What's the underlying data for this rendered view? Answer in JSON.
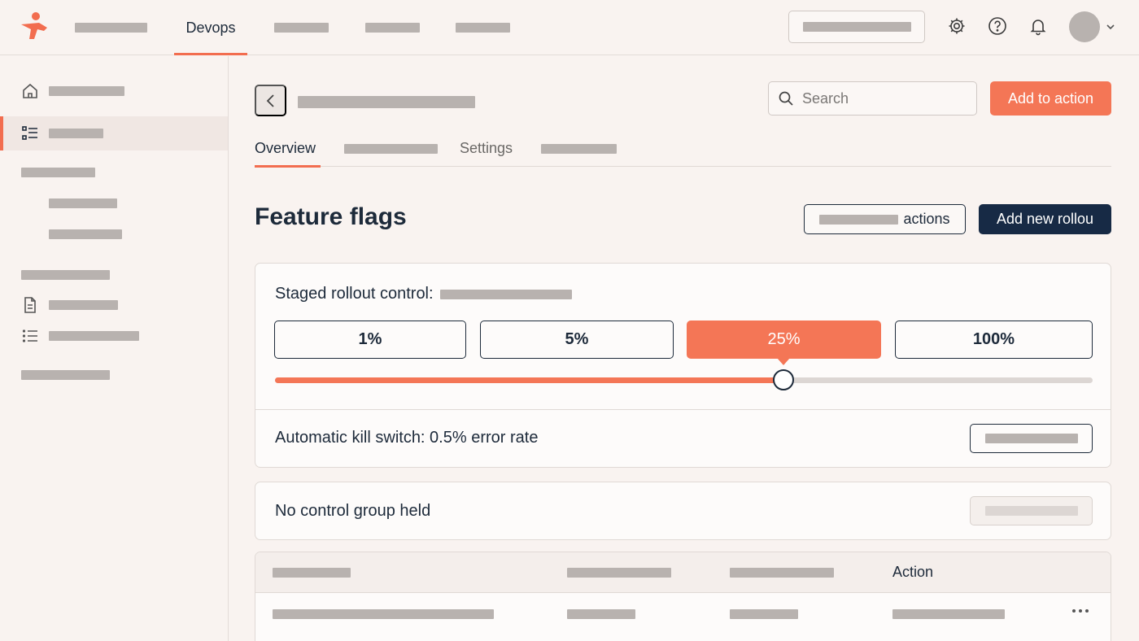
{
  "topnav": {
    "active_item": "Devops"
  },
  "main": {
    "search_placeholder": "Search",
    "add_to_action_label": "Add to action",
    "tabs": [
      {
        "label": "Overview",
        "active": true
      },
      {
        "label": "",
        "placeholder": true
      },
      {
        "label": "Settings",
        "active": false
      },
      {
        "label": "",
        "placeholder": true
      }
    ],
    "page_title": "Feature flags",
    "actions_button_suffix": "actions",
    "add_rollout_label": "Add new rollou"
  },
  "rollout": {
    "label": "Staged rollout control:",
    "options": [
      "1%",
      "5%",
      "25%",
      "100%"
    ],
    "selected": "25%",
    "slider_value_fraction": 0.622,
    "kill_switch_label": "Automatic kill switch: 0.5% error rate"
  },
  "control_group": {
    "label": "No control group held"
  },
  "table": {
    "action_header": "Action"
  },
  "colors": {
    "accent": "#f26d4f",
    "primary_dark": "#172a45",
    "background": "#f9f3f0"
  },
  "icons": {
    "logo": "brand-logo",
    "top": [
      "gear-icon",
      "help-icon",
      "bell-icon"
    ],
    "sidebar": [
      "home-icon",
      "list-icon",
      "document-icon",
      "bullet-list-icon"
    ]
  }
}
